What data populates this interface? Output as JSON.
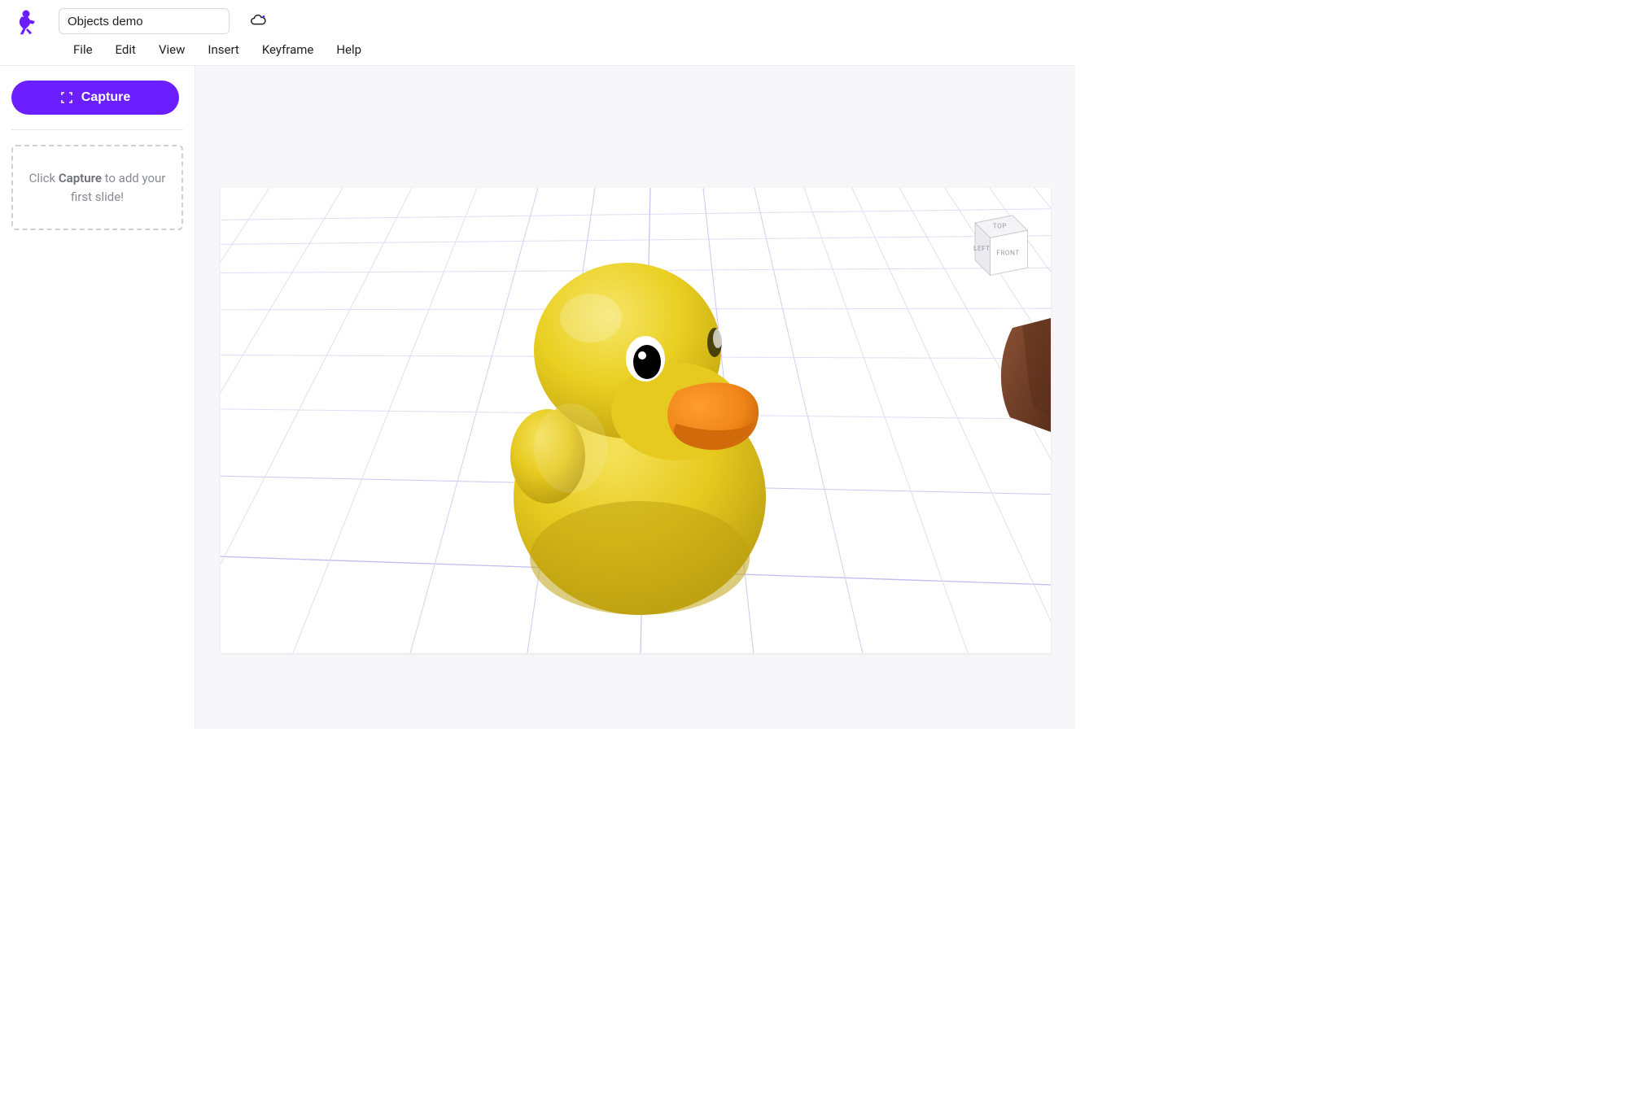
{
  "header": {
    "doc_title": "Objects demo",
    "menu": {
      "file": "File",
      "edit": "Edit",
      "view": "View",
      "insert": "Insert",
      "keyframe": "Keyframe",
      "help": "Help"
    }
  },
  "sidebar": {
    "capture_label": "Capture",
    "empty_hint_prefix": "Click ",
    "empty_hint_strong": "Capture",
    "empty_hint_suffix": " to add your first slide!"
  },
  "viewport": {
    "view_cube": {
      "top": "TOP",
      "left": "LEFT",
      "front": "FRONT"
    },
    "objects": {
      "main": "rubber-duck",
      "secondary": "wooden-chair-leg"
    }
  },
  "colors": {
    "accent": "#6b1fff",
    "grid_line": "#d9d0ff",
    "grid_line_strong": "#b7a8ff",
    "duck_body": "#e7ca1f",
    "duck_body_light": "#f2db3a",
    "duck_body_shadow": "#c5a90f",
    "duck_beak": "#f08a1a",
    "duck_beak_dark": "#d66d0e",
    "wood": "#6d3b24"
  }
}
